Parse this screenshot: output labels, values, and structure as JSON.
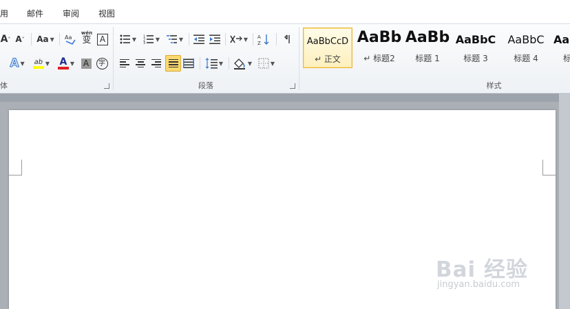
{
  "tabs": [
    {
      "label": "用"
    },
    {
      "label": "邮件"
    },
    {
      "label": "审阅"
    },
    {
      "label": "视图"
    }
  ],
  "font_group": {
    "label": "体",
    "change_case_label": "Aa",
    "pinyin_glyph": "wén",
    "pinyin_char": "文",
    "phonetic_char": "变",
    "border_char": "A",
    "enclose_char": "字",
    "grow_font": "A",
    "shrink_font": "A",
    "highlight_glyph": "ab",
    "font_color_glyph": "A",
    "shading_glyph": "A",
    "text_effect_glyph": "A",
    "highlight_color": "#ffff00",
    "font_color": "#e02020"
  },
  "paragraph_group": {
    "label": "段落"
  },
  "styles_group": {
    "label": "样式",
    "styles": [
      {
        "sample": "AaBbCcD",
        "name": "↵ 正文",
        "selected": true
      },
      {
        "sample": "AaBb",
        "name": "↵ 标题2",
        "selected": false
      },
      {
        "sample": "AaBb",
        "name": "标题 1",
        "selected": false
      },
      {
        "sample": "AaBbC",
        "name": "标题 3",
        "selected": false
      },
      {
        "sample": "AaBbC",
        "name": "标题 4",
        "selected": false
      },
      {
        "sample": "Aa",
        "name": "标",
        "selected": false
      }
    ]
  },
  "watermark": {
    "main": "Bai 经验",
    "sub": "jingyan.baidu.com"
  },
  "colors": {
    "active_highlight": "#fbd96e",
    "ribbon_bg": "#f5f7fa",
    "canvas_bg": "#abb0b7"
  }
}
